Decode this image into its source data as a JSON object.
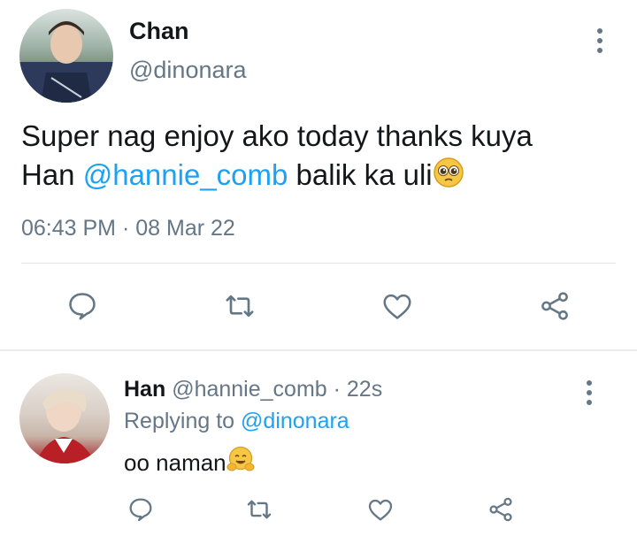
{
  "tweet": {
    "author_name": "Chan",
    "author_handle": "@dinonara",
    "text_line1": "Super nag enjoy ako today thanks kuya",
    "text_han": "Han ",
    "text_mention": "@hannie_comb",
    "text_after": " balik ka uli",
    "text_emoji": "pleading-face",
    "time": "06:43 PM",
    "dot": " · ",
    "date": "08 Mar 22"
  },
  "reply": {
    "author_name": "Han",
    "author_handle": "@hannie_comb",
    "dot": " · ",
    "age": "22s",
    "replying_label": "Replying to ",
    "replying_handle": "@dinonara",
    "text": "oo naman",
    "text_emoji": "hugging-face"
  },
  "colors": {
    "accent": "#1da1f2",
    "secondary_text": "#657786",
    "divider": "#e1e8ed"
  },
  "icons": [
    "reply-icon",
    "retweet-icon",
    "like-icon",
    "share-icon",
    "more-icon"
  ]
}
